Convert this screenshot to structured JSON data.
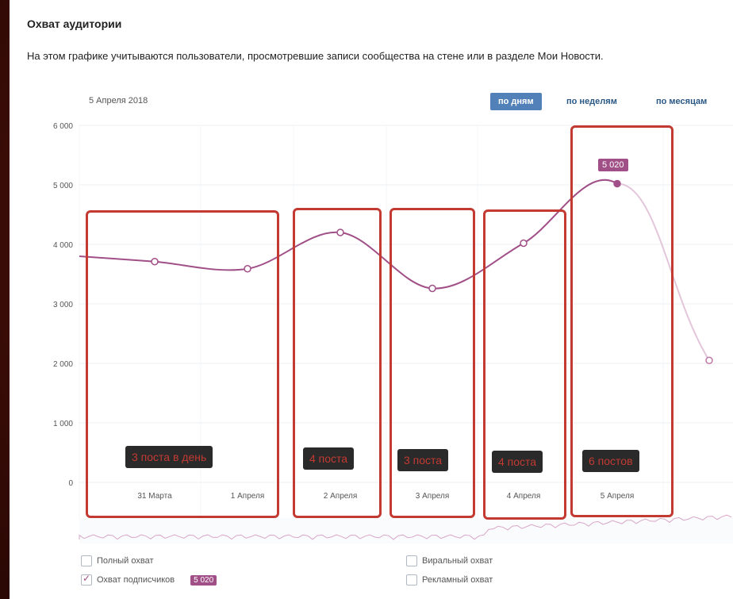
{
  "header": {
    "title": "Охват аудитории",
    "description": "На этом графике учитываются пользователи, просмотревшие записи сообщества на стене или в разделе Мои Новости."
  },
  "chart_controls": {
    "date": "5 Апреля 2018",
    "tabs": [
      {
        "label": "по дням",
        "active": true
      },
      {
        "label": "по неделям",
        "active": false
      },
      {
        "label": "по месяцам",
        "active": false
      }
    ]
  },
  "chart_data": {
    "type": "line",
    "categories": [
      "31 Марта",
      "1 Апреля",
      "2 Апреля",
      "3 Апреля",
      "4 Апреля",
      "5 Апреля"
    ],
    "y_ticks": [
      "0",
      "1 000",
      "2 000",
      "3 000",
      "4 000",
      "5 000",
      "6 000"
    ],
    "ylim": [
      0,
      6000
    ],
    "series": [
      {
        "name": "Охват подписчиков",
        "color": "#a14f87",
        "values": [
          3710,
          3590,
          4200,
          3260,
          4020,
          5020
        ],
        "next_value": 2050,
        "start_value": 3800
      }
    ],
    "tooltip_value": "5 020",
    "grid": true
  },
  "legend": {
    "items": [
      {
        "label": "Полный охват",
        "checked": false
      },
      {
        "label": "Охват подписчиков",
        "checked": true,
        "badge": "5 020"
      },
      {
        "label": "Виральный охват",
        "checked": false
      },
      {
        "label": "Рекламный охват",
        "checked": false
      }
    ]
  },
  "annotations": [
    {
      "label": "3 поста в день"
    },
    {
      "label": "4 поста"
    },
    {
      "label": "3 поста"
    },
    {
      "label": "4 поста"
    },
    {
      "label": "6 постов"
    }
  ],
  "colors": {
    "annotation_border": "#c33a33",
    "line": "#a14f87",
    "active_tab": "#5181b8"
  }
}
